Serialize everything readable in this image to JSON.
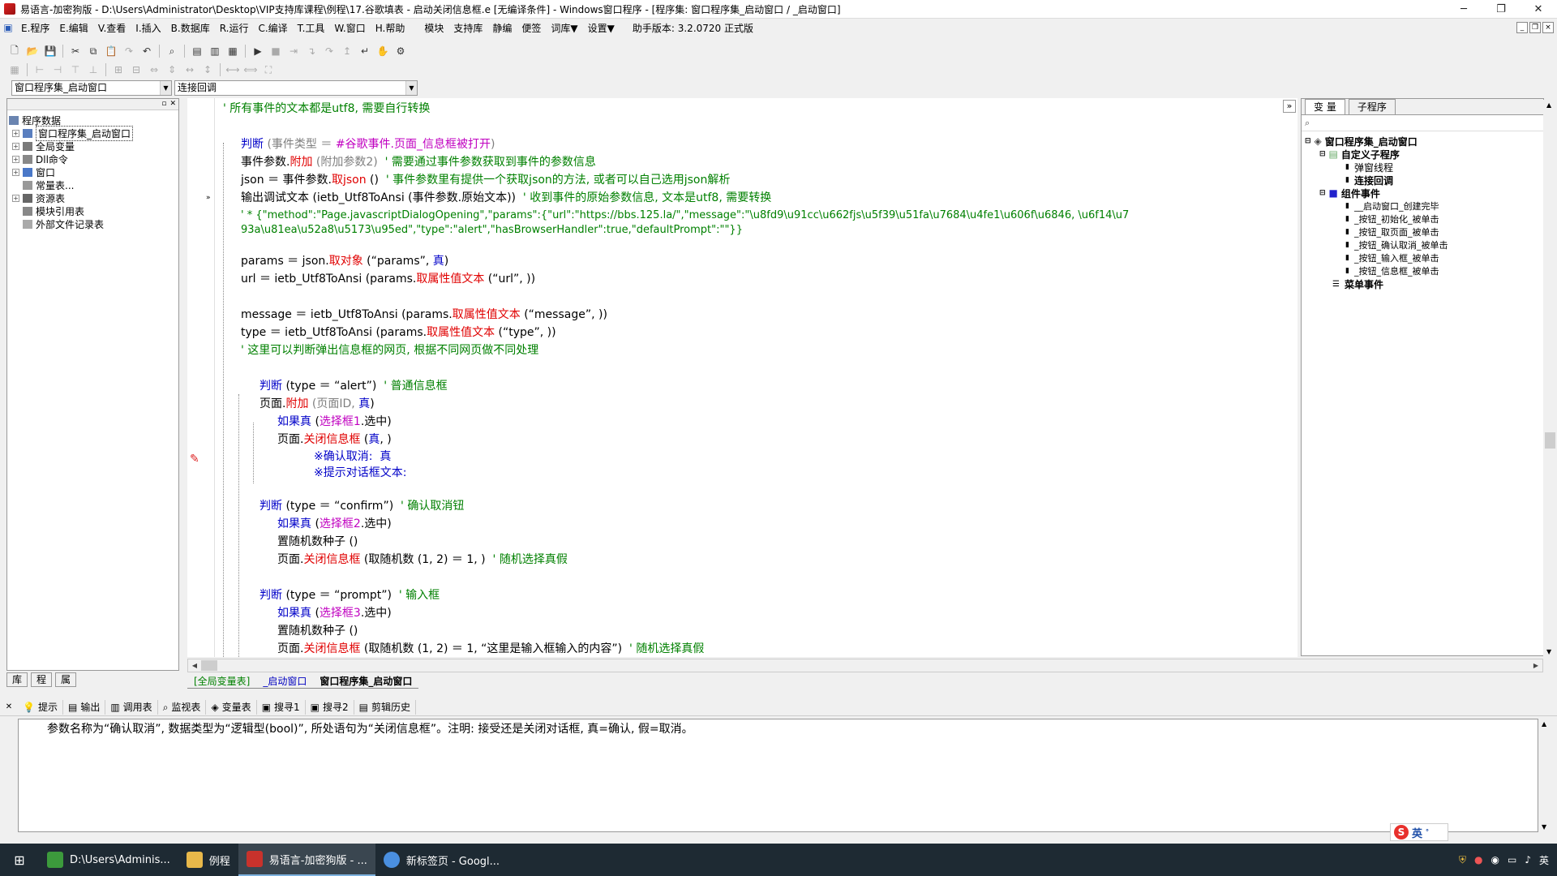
{
  "window": {
    "title": "易语言-加密狗版 - D:\\Users\\Administrator\\Desktop\\VIP支持库课程\\例程\\17.谷歌填表 - 启动关闭信息框.e [无编译条件] - Windows窗口程序 - [程序集: 窗口程序集_启动窗口 / _启动窗口]",
    "minimize": "─",
    "maximize": "❐",
    "close": "✕"
  },
  "menu": {
    "items": [
      "E.程序",
      "E.编辑",
      "V.查看",
      "I.插入",
      "B.数据库",
      "R.运行",
      "C.编译",
      "T.工具",
      "W.窗口",
      "H.帮助",
      "模块",
      "支持库",
      "静编",
      "便签",
      "词库▼",
      "设置▼"
    ],
    "version": "助手版本: 3.2.0720 正式版"
  },
  "combos": {
    "assembly": "窗口程序集_启动窗口",
    "method": "连接回调"
  },
  "left_tree": {
    "root": "程序数据",
    "items": [
      {
        "label": "窗口程序集_启动窗口",
        "expand": "+",
        "selected": true
      },
      {
        "label": "全局变量",
        "expand": "+"
      },
      {
        "label": "Dll命令",
        "expand": "+"
      },
      {
        "label": "窗口",
        "expand": "+"
      },
      {
        "label": "常量表...",
        "expand": ""
      },
      {
        "label": "资源表",
        "expand": "+"
      },
      {
        "label": "模块引用表",
        "expand": ""
      },
      {
        "label": "外部文件记录表",
        "expand": ""
      }
    ]
  },
  "left_tabs": [
    "库",
    "程",
    "属"
  ],
  "code": {
    "l1_comment": "' 所有事件的文本都是utf8, 需要自行转换",
    "l2_kw": "判断",
    "l2_a": " (事件类型 ＝ ",
    "l2_b": "#谷歌事件.页面_信息框被打开",
    "l2_c": ")",
    "l3_a": "事件参数.",
    "l3_b": "附加",
    "l3_c": " (附加参数2)",
    "l3_cm": "  ' 需要通过事件参数获取到事件的参数信息",
    "l4_a": "json ＝ 事件参数.",
    "l4_b": "取json",
    "l4_c": " ()",
    "l4_cm": "  ' 事件参数里有提供一个获取json的方法, 或者可以自己选用json解析",
    "l5_a": "输出调试文本 (ietb_Utf8ToAnsi (事件参数.原始文本))",
    "l5_cm": "  ' 收到事件的原始参数信息, 文本是utf8, 需要转换",
    "l6_a": "' * {\"method\":\"Page.javascriptDialogOpening\",\"params\":{\"url\":\"https://bbs.125.la/\",\"message\":\"\\u8fd9\\u91cc\\u662fjs\\u5f39\\u51fa\\u7684\\u4fe1\\u606f\\u6846, \\u6f14\\u7",
    "l7_a": "93a\\u81ea\\u52a8\\u5173\\u95ed\",\"type\":\"alert\",\"hasBrowserHandler\":true,\"defaultPrompt\":\"\"}}",
    "l8_a": "params ＝ json.",
    "l8_b": "取对象",
    "l8_c": " (“params”, ",
    "l8_d": "真",
    "l8_e": ")",
    "l9_a": "url ＝ ietb_Utf8ToAnsi (params.",
    "l9_b": "取属性值文本",
    "l9_c": " (“url”, ))",
    "l10_a": "message ＝ ietb_Utf8ToAnsi (params.",
    "l10_b": "取属性值文本",
    "l10_c": " (“message”, ))",
    "l11_a": "type ＝ ietb_Utf8ToAnsi (params.",
    "l11_b": "取属性值文本",
    "l11_c": " (“type”, ))",
    "l12_cm": "' 这里可以判断弹出信息框的网页, 根据不同网页做不同处理",
    "l13_kw": "判断",
    "l13_a": " (type ＝ “alert”)",
    "l13_cm": "  ' 普通信息框",
    "l14_a": "页面.",
    "l14_b": "附加",
    "l14_c": " (页面ID, ",
    "l14_d": "真",
    "l14_e": ")",
    "l15_kw": "如果真",
    "l15_a": " (",
    "l15_b": "选择框1",
    "l15_c": ".选中)",
    "l16_a": "页面.",
    "l16_b": "关闭信息框",
    "l16_c": " (",
    "l16_d": "真",
    "l16_e": ", )",
    "l17_a": "※确认取消:  真",
    "l18_a": "※提示对话框文本:",
    "l19_kw": "判断",
    "l19_a": " (type ＝ “confirm”)",
    "l19_cm": "  ' 确认取消钮",
    "l20_kw": "如果真",
    "l20_a": " (",
    "l20_b": "选择框2",
    "l20_c": ".选中)",
    "l21_a": "置随机数种子 ()",
    "l22_a": "页面.",
    "l22_b": "关闭信息框",
    "l22_c": " (取随机数 (1, 2) ＝ 1, )",
    "l22_cm": "  ' 随机选择真假",
    "l23_kw": "判断",
    "l23_a": " (type ＝ “prompt”)",
    "l23_cm": "  ' 输入框",
    "l24_kw": "如果真",
    "l24_a": " (",
    "l24_b": "选择框3",
    "l24_c": ".选中)",
    "l25_a": "置随机数种子 ()",
    "l26_a": "页面.",
    "l26_b": "关闭信息框",
    "l26_c": " (取随机数 (1, 2) ＝ 1, “这里是输入框输入的内容”)",
    "l26_cm": "  ' 随机选择真假"
  },
  "editor_tabs": [
    "[全局变量表]",
    "_启动窗口",
    "窗口程序集_启动窗口"
  ],
  "right_panel": {
    "tabs": [
      "变 量",
      "子程序"
    ],
    "tree": [
      {
        "label": "窗口程序集_启动窗口",
        "bold": true,
        "level": 0
      },
      {
        "label": "自定义子程序",
        "bold": true,
        "level": 1
      },
      {
        "label": "弹窗线程",
        "bold": false,
        "level": 2
      },
      {
        "label": "连接回调",
        "bold": true,
        "level": 2
      },
      {
        "label": "组件事件",
        "bold": true,
        "level": 1
      },
      {
        "label": "__启动窗口_创建完毕",
        "bold": false,
        "level": 2
      },
      {
        "label": "_按钮_初始化_被单击",
        "bold": false,
        "level": 2
      },
      {
        "label": "_按钮_取页面_被单击",
        "bold": false,
        "level": 2
      },
      {
        "label": "_按钮_确认取消_被单击",
        "bold": false,
        "level": 2
      },
      {
        "label": "_按钮_输入框_被单击",
        "bold": false,
        "level": 2
      },
      {
        "label": "_按钮_信息框_被单击",
        "bold": false,
        "level": 2
      },
      {
        "label": "菜单事件",
        "bold": true,
        "level": 1
      }
    ]
  },
  "bottom_tabs": [
    "提示",
    "输出",
    "调用表",
    "监视表",
    "变量表",
    "搜寻1",
    "搜寻2",
    "剪辑历史"
  ],
  "output_text": "参数名称为“确认取消”, 数据类型为“逻辑型(bool)”, 所处语句为“关闭信息框”。注明: 接受还是关闭对话框, 真=确认, 假=取消。",
  "ime": {
    "label": "英"
  },
  "taskbar": {
    "start": "⊞",
    "tasks": [
      {
        "label": "D:\\Users\\Adminis...",
        "color": "#3c9a3c",
        "active": false
      },
      {
        "label": "例程",
        "color": "#e8b84a",
        "active": false
      },
      {
        "label": "易语言-加密狗版 - ...",
        "color": "#c8322c",
        "active": true
      },
      {
        "label": "新标签页 - Googl...",
        "color": "#4a8fe0",
        "active": false
      }
    ],
    "tray_lang": "英"
  }
}
